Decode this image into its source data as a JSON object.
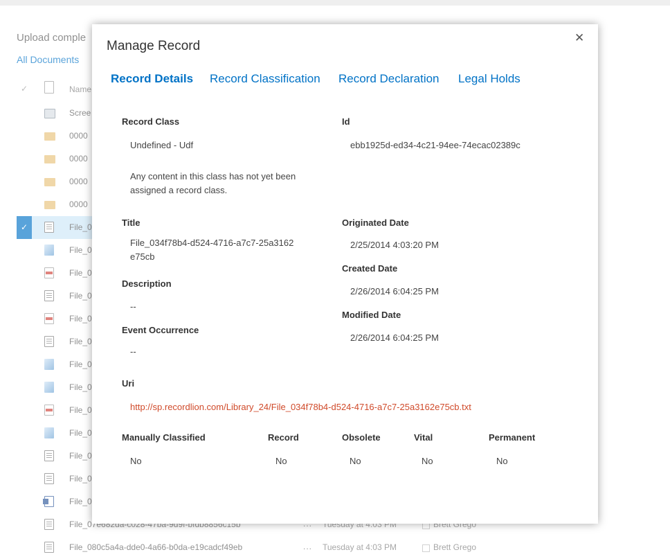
{
  "background": {
    "upload_status": "Upload comple",
    "view_name": "All Documents",
    "column_name": "Name",
    "rows": [
      {
        "icon": "image-icon-screen",
        "name": "Scree",
        "selected": false
      },
      {
        "icon": "folder-icon",
        "name": "0000",
        "selected": false
      },
      {
        "icon": "folder-icon",
        "name": "0000",
        "selected": false
      },
      {
        "icon": "folder-icon",
        "name": "0000",
        "selected": false
      },
      {
        "icon": "folder-icon",
        "name": "0000",
        "selected": false
      },
      {
        "icon": "text-file-icon",
        "name": "File_0",
        "selected": true
      },
      {
        "icon": "image-file-icon",
        "name": "File_0",
        "selected": false
      },
      {
        "icon": "pdf-file-icon",
        "name": "File_0",
        "selected": false
      },
      {
        "icon": "text-file-icon",
        "name": "File_0",
        "selected": false
      },
      {
        "icon": "pdf-file-icon",
        "name": "File_0",
        "selected": false
      },
      {
        "icon": "text-file-icon",
        "name": "File_0",
        "selected": false
      },
      {
        "icon": "image-file-icon",
        "name": "File_0",
        "selected": false
      },
      {
        "icon": "image-file-icon",
        "name": "File_0",
        "selected": false
      },
      {
        "icon": "pdf-file-icon",
        "name": "File_0",
        "selected": false
      },
      {
        "icon": "image-file-icon",
        "name": "File_0",
        "selected": false
      },
      {
        "icon": "text-file-icon",
        "name": "File_0",
        "selected": false
      },
      {
        "icon": "text-file-icon",
        "name": "File_0",
        "selected": false
      },
      {
        "icon": "word-file-icon",
        "name": "File_0",
        "selected": false
      },
      {
        "icon": "text-file-icon",
        "name": "File_07e682da-c028-47ba-9d9f-bfdb8856c15b",
        "selected": false,
        "dots": "...",
        "modified": "Tuesday at 4:03 PM",
        "modified_by": "Brett Grego"
      },
      {
        "icon": "text-file-icon",
        "name": "File_080c5a4a-dde0-4a66-b0da-e19cadcf49eb",
        "selected": false,
        "dots": "...",
        "modified": "Tuesday at 4:03 PM",
        "modified_by": "Brett Grego"
      }
    ]
  },
  "dialog": {
    "title": "Manage Record",
    "close_glyph": "✕",
    "tabs": [
      {
        "label": "Record Details",
        "active": true
      },
      {
        "label": "Record Classification",
        "active": false
      },
      {
        "label": "Record Declaration",
        "active": false
      },
      {
        "label": "Legal Holds",
        "active": false
      }
    ],
    "record_class": {
      "label": "Record Class",
      "value": "Undefined - Udf",
      "description": "Any content in this class has not yet been assigned a record class."
    },
    "id": {
      "label": "Id",
      "value": "ebb1925d-ed34-4c21-94ee-74ecac02389c"
    },
    "title_field": {
      "label": "Title",
      "value": "File_034f78b4-d524-4716-a7c7-25a3162e75cb"
    },
    "description": {
      "label": "Description",
      "value": "--"
    },
    "event_occurrence": {
      "label": "Event Occurrence",
      "value": "--"
    },
    "originated_date": {
      "label": "Originated Date",
      "value": "2/25/2014 4:03:20 PM"
    },
    "created_date": {
      "label": "Created Date",
      "value": "2/26/2014 6:04:25 PM"
    },
    "modified_date": {
      "label": "Modified Date",
      "value": "2/26/2014 6:04:25 PM"
    },
    "uri": {
      "label": "Uri",
      "value": "http://sp.recordlion.com/Library_24/File_034f78b4-d524-4716-a7c7-25a3162e75cb.txt"
    },
    "flags": [
      {
        "label": "Manually Classified",
        "value": "No"
      },
      {
        "label": "Record",
        "value": "No"
      },
      {
        "label": "Obsolete",
        "value": "No"
      },
      {
        "label": "Vital",
        "value": "No"
      },
      {
        "label": "Permanent",
        "value": "No"
      }
    ],
    "colors": {
      "accent": "#0072c6",
      "link": "#d04a2a"
    }
  }
}
